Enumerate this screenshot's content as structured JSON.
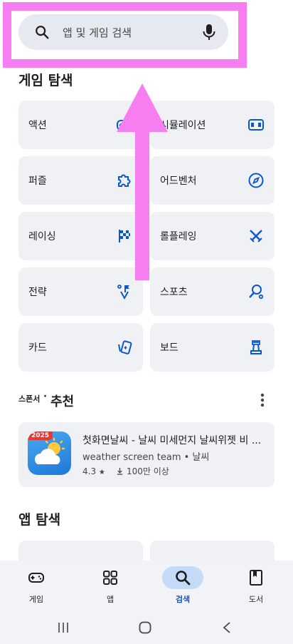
{
  "search": {
    "placeholder": "앱 및 게임 검색"
  },
  "game_section": {
    "title": "게임 탐색",
    "categories": [
      {
        "label": "액션",
        "icon": "gamepad-icon"
      },
      {
        "label": "시뮬레이션",
        "icon": "simulation-icon"
      },
      {
        "label": "퍼즐",
        "icon": "puzzle-icon"
      },
      {
        "label": "어드벤처",
        "icon": "compass-icon"
      },
      {
        "label": "레이싱",
        "icon": "checkered-flag-icon"
      },
      {
        "label": "롤플레잉",
        "icon": "crossed-swords-icon"
      },
      {
        "label": "전략",
        "icon": "strategy-icon"
      },
      {
        "label": "스포츠",
        "icon": "sports-icon"
      },
      {
        "label": "카드",
        "icon": "cards-icon"
      },
      {
        "label": "보드",
        "icon": "chess-piece-icon"
      }
    ]
  },
  "sponsored": {
    "ad_label": "스폰서",
    "dot": "·",
    "title": "추천",
    "app": {
      "badge": "2025",
      "name": "첫화면날씨 - 날씨 미세먼지 날씨위젯 비 ...",
      "developer": "weather screen team",
      "category": "• 날씨",
      "rating": "4.3",
      "star": "★",
      "downloads": "100만 이상"
    }
  },
  "app_section": {
    "title": "앱 탐색"
  },
  "bottom_nav": [
    {
      "label": "게임",
      "icon": "gamepad-icon",
      "active": false
    },
    {
      "label": "앱",
      "icon": "apps-grid-icon",
      "active": false
    },
    {
      "label": "검색",
      "icon": "search-icon",
      "active": true
    },
    {
      "label": "도서",
      "icon": "book-icon",
      "active": false
    }
  ],
  "colors": {
    "accent": "#0b57d0",
    "highlight": "#f77ef0",
    "card_bg": "#eff1f5"
  }
}
